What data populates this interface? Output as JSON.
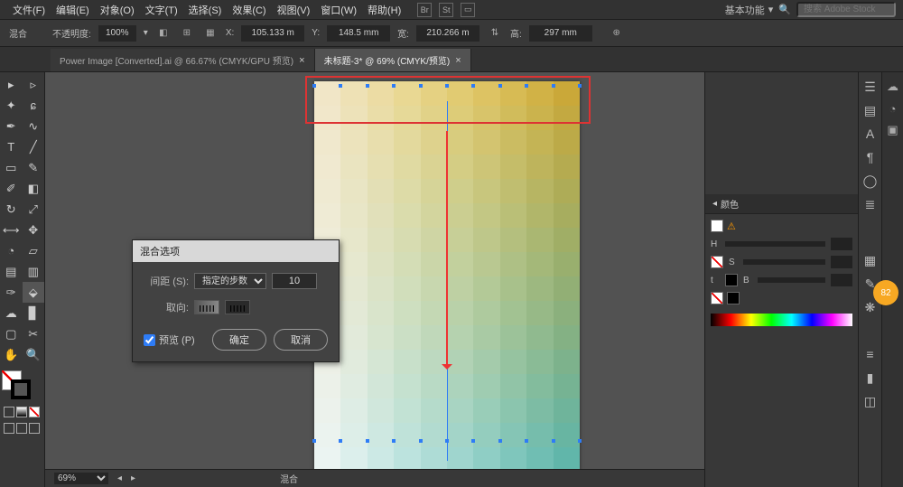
{
  "menu": {
    "items": [
      "文件(F)",
      "编辑(E)",
      "对象(O)",
      "文字(T)",
      "选择(S)",
      "效果(C)",
      "视图(V)",
      "窗口(W)",
      "帮助(H)"
    ]
  },
  "workspace": {
    "label": "基本功能",
    "search_placeholder": "搜索 Adobe Stock"
  },
  "options": {
    "tool_label": "混合",
    "opacity_label": "不透明度:",
    "opacity": "100%",
    "x_label": "X:",
    "x": "105.133 m",
    "y_label": "Y:",
    "y": "148.5 mm",
    "w_label": "宽:",
    "w": "210.266 m",
    "h_label": "高:",
    "h": "297 mm"
  },
  "tabs": [
    {
      "label": "Power Image [Converted].ai @ 66.67% (CMYK/GPU 预览)",
      "active": false
    },
    {
      "label": "未标题-3* @ 69% (CMYK/预览)",
      "active": true
    }
  ],
  "dialog": {
    "title": "混合选项",
    "spacing_label": "间距 (S):",
    "spacing_mode": "指定的步数",
    "spacing_value": "10",
    "orient_label": "取向:",
    "preview_label": "预览 (P)",
    "ok": "确定",
    "cancel": "取消"
  },
  "status": {
    "zoom": "69%",
    "tool": "混合"
  },
  "panels": {
    "color": "颜色",
    "channels": [
      "H",
      "S",
      "B"
    ],
    "t_label": "t"
  },
  "badge": "82",
  "gradient": {
    "top": [
      "#f1e6c7",
      "#eee1b5",
      "#ecdca4",
      "#e9d893",
      "#e5d182",
      "#e1cb72",
      "#ddc363",
      "#d7bb54",
      "#d1b246",
      "#caa839"
    ],
    "bot": [
      "#ebf4f2",
      "#dcefec",
      "#cce9e5",
      "#bce3de",
      "#aedcd6",
      "#9fd5ce",
      "#8fcec5",
      "#7fc6bc",
      "#70beb3",
      "#61b6aa"
    ]
  }
}
